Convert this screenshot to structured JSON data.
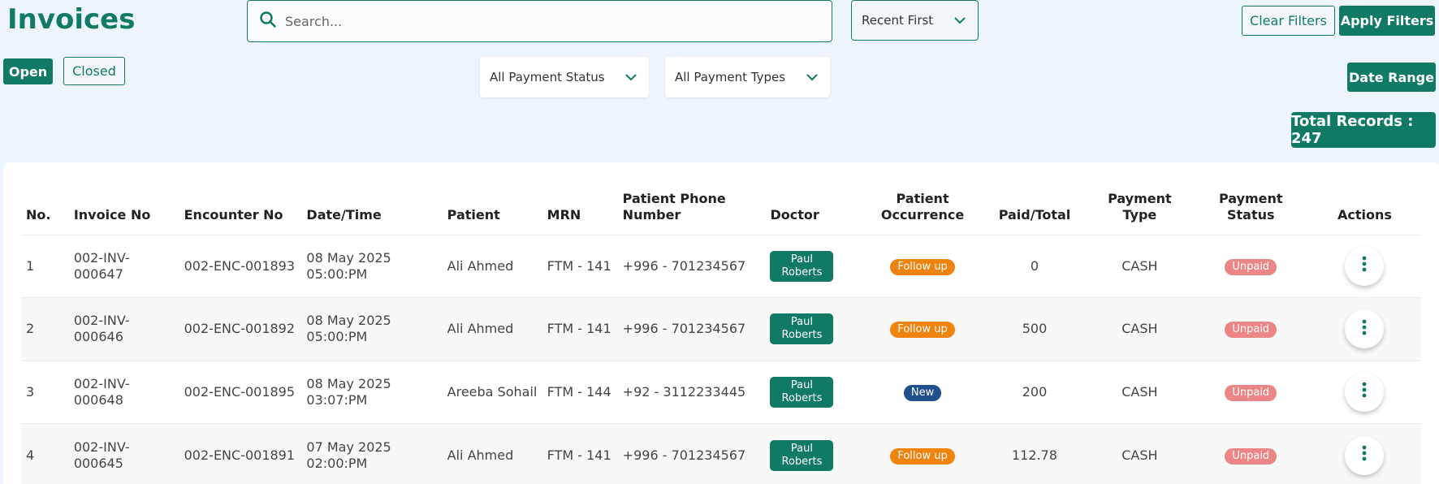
{
  "header": {
    "title": "Invoices",
    "search_placeholder": "Search...",
    "sort_label": "Recent First",
    "clear_label": "Clear Filters",
    "apply_label": "Apply Filters"
  },
  "filters": {
    "open_label": "Open",
    "closed_label": "Closed",
    "payment_status": "All Payment Status",
    "payment_types": "All Payment Types",
    "date_range_label": "Date Range",
    "total_records": "Total Records : 247"
  },
  "table": {
    "headers": [
      "No.",
      "Invoice No",
      "Encounter No",
      "Date/Time",
      "Patient",
      "MRN",
      "Patient Phone Number",
      "Doctor",
      "Patient Occurrence",
      "Paid/Total",
      "Payment Type",
      "Payment Status",
      "Actions"
    ],
    "rows": [
      {
        "no": "1",
        "invoice": "002-INV-000647",
        "encounter": "002-ENC-001893",
        "date": "08 May 2025",
        "time": "05:00:PM",
        "patient": "Ali Ahmed",
        "mrn": "FTM - 141",
        "phone": "+996 - 701234567",
        "doctor": "Paul Roberts",
        "occurrence": "Follow up",
        "paid": "0",
        "type": "CASH",
        "status": "Unpaid"
      },
      {
        "no": "2",
        "invoice": "002-INV-000646",
        "encounter": "002-ENC-001892",
        "date": "08 May 2025",
        "time": "05:00:PM",
        "patient": "Ali Ahmed",
        "mrn": "FTM - 141",
        "phone": "+996 - 701234567",
        "doctor": "Paul Roberts",
        "occurrence": "Follow up",
        "paid": "500",
        "type": "CASH",
        "status": "Unpaid"
      },
      {
        "no": "3",
        "invoice": "002-INV-000648",
        "encounter": "002-ENC-001895",
        "date": "08 May 2025",
        "time": "03:07:PM",
        "patient": "Areeba Sohail",
        "mrn": "FTM - 144",
        "phone": "+92 - 3112233445",
        "doctor": "Paul Roberts",
        "occurrence": "New",
        "paid": "200",
        "type": "CASH",
        "status": "Unpaid"
      },
      {
        "no": "4",
        "invoice": "002-INV-000645",
        "encounter": "002-ENC-001891",
        "date": "07 May 2025",
        "time": "02:00:PM",
        "patient": "Ali Ahmed",
        "mrn": "FTM - 141",
        "phone": "+996 - 701234567",
        "doctor": "Paul Roberts",
        "occurrence": "Follow up",
        "paid": "112.78",
        "type": "CASH",
        "status": "Unpaid"
      }
    ]
  },
  "colors": {
    "accent": "#117a65",
    "follow_up": "#f0820f",
    "new": "#1f4f8c",
    "unpaid": "#ec8585"
  },
  "icons": {
    "search": "search-icon",
    "dropdown": "chevron-down-icon",
    "actions": "more-vertical-icon"
  }
}
